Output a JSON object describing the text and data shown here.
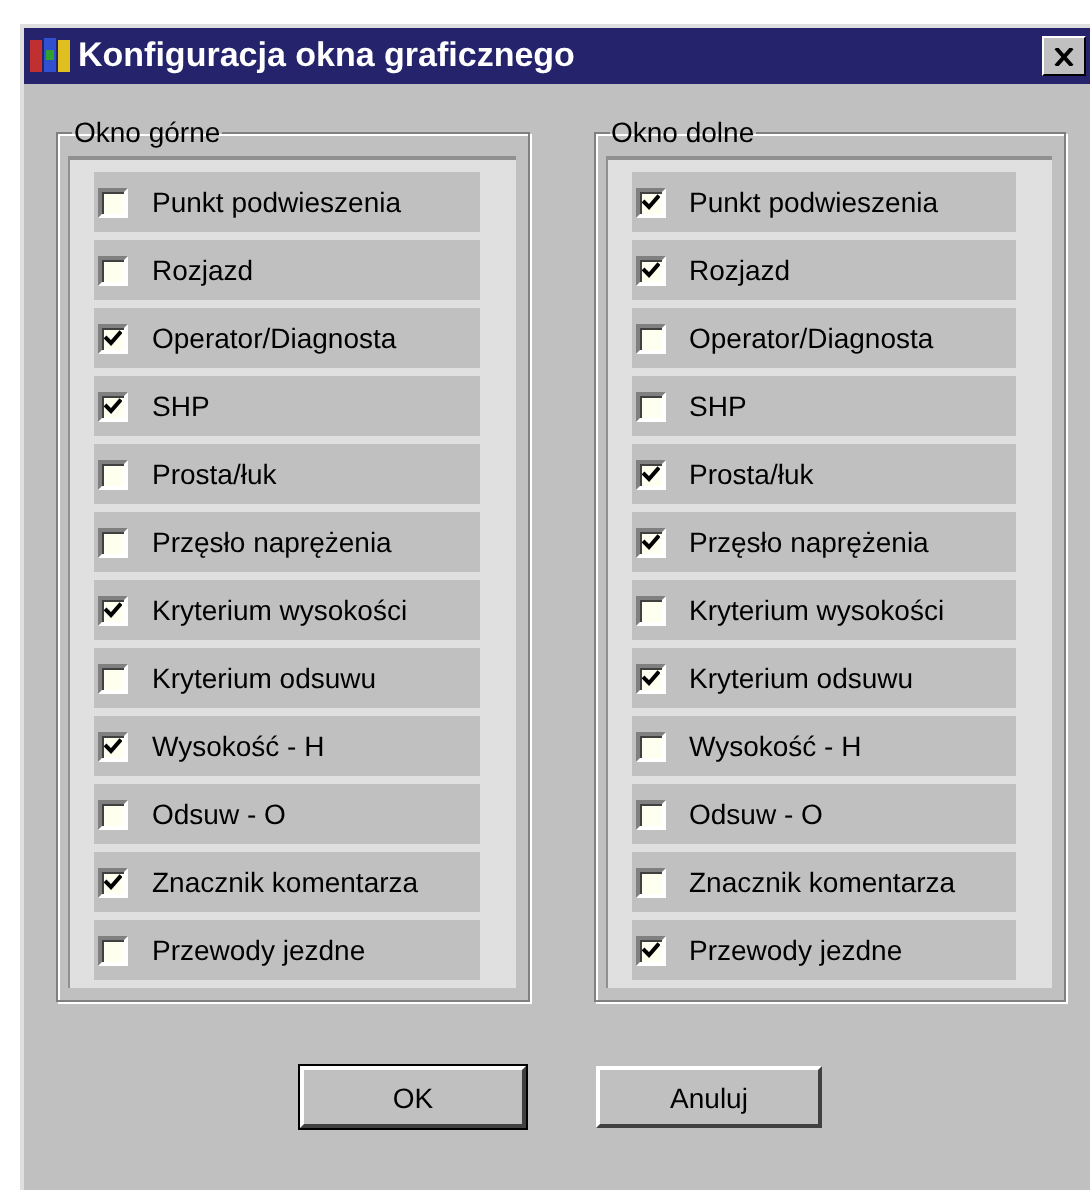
{
  "window": {
    "title": "Konfiguracja okna graficznego"
  },
  "groups": [
    {
      "title": "Okno górne",
      "items": [
        {
          "label": "Punkt podwieszenia",
          "checked": false
        },
        {
          "label": "Rozjazd",
          "checked": false
        },
        {
          "label": "Operator/Diagnosta",
          "checked": true
        },
        {
          "label": "SHP",
          "checked": true
        },
        {
          "label": "Prosta/łuk",
          "checked": false
        },
        {
          "label": "Przęsło naprężenia",
          "checked": false
        },
        {
          "label": "Kryterium wysokości",
          "checked": true
        },
        {
          "label": "Kryterium odsuwu",
          "checked": false
        },
        {
          "label": "Wysokość - H",
          "checked": true
        },
        {
          "label": "Odsuw - O",
          "checked": false
        },
        {
          "label": "Znacznik komentarza",
          "checked": true
        },
        {
          "label": "Przewody jezdne",
          "checked": false
        }
      ]
    },
    {
      "title": "Okno dolne",
      "items": [
        {
          "label": "Punkt podwieszenia",
          "checked": true
        },
        {
          "label": "Rozjazd",
          "checked": true
        },
        {
          "label": "Operator/Diagnosta",
          "checked": false
        },
        {
          "label": "SHP",
          "checked": false
        },
        {
          "label": "Prosta/łuk",
          "checked": true
        },
        {
          "label": "Przęsło naprężenia",
          "checked": true
        },
        {
          "label": "Kryterium wysokości",
          "checked": false
        },
        {
          "label": "Kryterium odsuwu",
          "checked": true
        },
        {
          "label": "Wysokość - H",
          "checked": false
        },
        {
          "label": "Odsuw - O",
          "checked": false
        },
        {
          "label": "Znacznik komentarza",
          "checked": false
        },
        {
          "label": "Przewody jezdne",
          "checked": true
        }
      ]
    }
  ],
  "buttons": [
    {
      "label": "OK",
      "default": true
    },
    {
      "label": "Anuluj",
      "default": false
    }
  ]
}
